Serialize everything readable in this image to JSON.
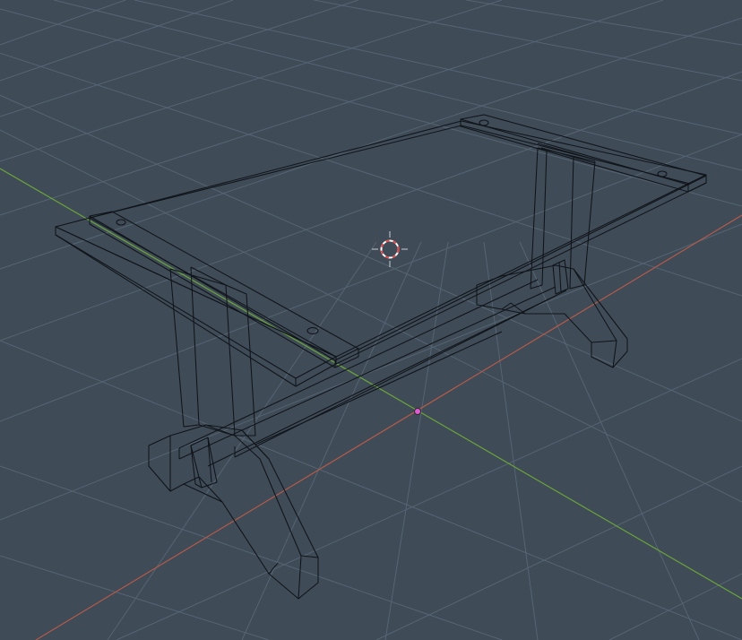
{
  "viewport": {
    "background_color": "#3f4b57",
    "grid_color": "#566473",
    "axis_x_color": "#b45a4a",
    "axis_y_color": "#6aa33a",
    "wire_color": "#101419"
  },
  "scene": {
    "object": "table-wireframe",
    "view_mode": "wireframe"
  },
  "cursor_3d": {
    "icon": "3d-cursor-icon",
    "ring_colors": [
      "#e04a4a",
      "#ffffff"
    ]
  },
  "origin": {
    "icon": "origin-point-icon",
    "color": "#e05ad6"
  }
}
